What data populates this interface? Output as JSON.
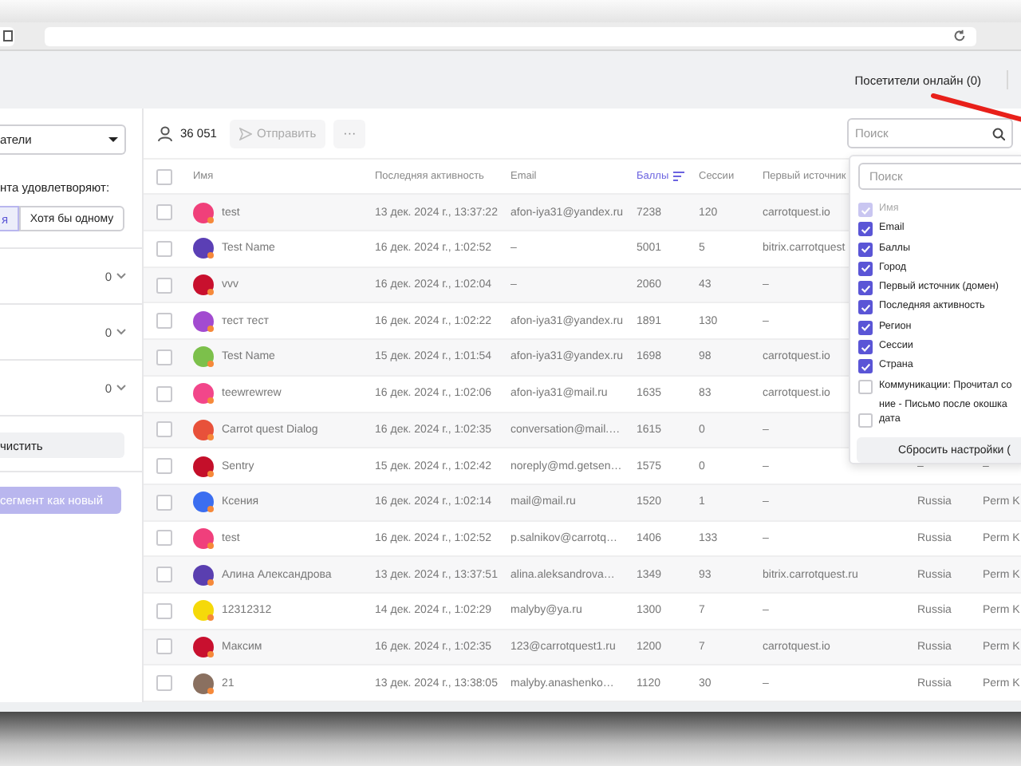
{
  "header": {
    "online_visitors": "Посетители онлайн (0)"
  },
  "sidebar": {
    "segment_select": "атели",
    "match_label": "нта удовлетворяют:",
    "match_modes": [
      {
        "label": "я",
        "selected": true
      },
      {
        "label": "Хотя бы одному",
        "selected": false
      }
    ],
    "filter_groups": [
      {
        "count": "0"
      },
      {
        "count": "0"
      },
      {
        "count": "0"
      }
    ],
    "clear_button": "чистить",
    "save_button": "сегмент как новый"
  },
  "toolbar": {
    "count": "36 051",
    "send_button": "Отправить",
    "more_button": "···",
    "search": {
      "placeholder": "Поиск"
    }
  },
  "table": {
    "select_all": {
      "checked": false
    },
    "columns": [
      {
        "label": "Имя",
        "sorted": false
      },
      {
        "label": "Последняя активность",
        "sorted": false
      },
      {
        "label": "Email",
        "sorted": false
      },
      {
        "label": "Баллы",
        "sorted": true
      },
      {
        "label": "Сессии",
        "sorted": false
      },
      {
        "label": "Первый источник",
        "sorted": false
      }
    ],
    "rows": [
      {
        "checked": false,
        "color": "#f0407a",
        "name": "test",
        "last_active": "13 дек. 2024 г., 13:37:22",
        "email": "afon-iya31@yandex.ru",
        "score": "7238",
        "sessions": "120",
        "source": "carrotquest.io"
      },
      {
        "checked": false,
        "color": "#5b3fb5",
        "name": "Test Name",
        "last_active": "16 дек. 2024 г., 1:02:52",
        "email": "–",
        "score": "5001",
        "sessions": "5",
        "source": "bitrix.carrotquest"
      },
      {
        "checked": false,
        "color": "#c8102e",
        "name": "vvv",
        "last_active": "16 дек. 2024 г., 1:02:04",
        "email": "–",
        "score": "2060",
        "sessions": "43",
        "source": "–"
      },
      {
        "checked": false,
        "color": "#a24bd0",
        "name": "тест тест",
        "last_active": "16 дек. 2024 г., 1:02:22",
        "email": "afon-iya31@yandex.ru",
        "score": "1891",
        "sessions": "130",
        "source": "–"
      },
      {
        "checked": false,
        "color": "#7cc04b",
        "name": "Test Name",
        "last_active": "15 дек. 2024 г., 1:01:54",
        "email": "afon-iya31@yandex.ru",
        "score": "1698",
        "sessions": "98",
        "source": "carrotquest.io"
      },
      {
        "checked": false,
        "color": "#f2468a",
        "name": "teewrewrew",
        "last_active": "16 дек. 2024 г., 1:02:06",
        "email": "afon-iya31@mail.ru",
        "score": "1635",
        "sessions": "83",
        "source": "carrotquest.io"
      },
      {
        "checked": false,
        "color": "#e8513a",
        "name": "Carrot quest Dialog",
        "last_active": "16 дек. 2024 г., 1:02:35",
        "email": "conversation@mail.…",
        "score": "1615",
        "sessions": "0",
        "source": "–"
      },
      {
        "checked": false,
        "color": "#c40f2a",
        "name": "Sentry",
        "last_active": "15 дек. 2024 г., 1:02:42",
        "email": "noreply@md.getsen…",
        "score": "1575",
        "sessions": "0",
        "source": "–",
        "country": "–",
        "city": "–"
      },
      {
        "checked": false,
        "color": "#3b6ef0",
        "name": "Ксения",
        "last_active": "16 дек. 2024 г., 1:02:14",
        "email": "mail@mail.ru",
        "score": "1520",
        "sessions": "1",
        "source": "–",
        "country": "Russia",
        "city": "Perm K"
      },
      {
        "checked": false,
        "color": "#f03f7c",
        "name": "test",
        "last_active": "16 дек. 2024 г., 1:02:52",
        "email": "p.salnikov@carrotq…",
        "score": "1406",
        "sessions": "133",
        "source": "–",
        "country": "Russia",
        "city": "Perm K"
      },
      {
        "checked": false,
        "color": "#5a3fb0",
        "name": "Алина Александрова",
        "last_active": "13 дек. 2024 г., 13:37:51",
        "email": "alina.aleksandrova…",
        "score": "1349",
        "sessions": "93",
        "source": "bitrix.carrotquest.ru",
        "country": "Russia",
        "city": "Perm K"
      },
      {
        "checked": false,
        "color": "#f5d90a",
        "name": "12312312",
        "last_active": "14 дек. 2024 г., 1:02:29",
        "email": "malyby@ya.ru",
        "score": "1300",
        "sessions": "7",
        "source": "–",
        "country": "Russia",
        "city": "Perm K"
      },
      {
        "checked": false,
        "color": "#c8102f",
        "name": "Максим",
        "last_active": "16 дек. 2024 г., 1:02:35",
        "email": "123@carrotquest1.ru",
        "score": "1200",
        "sessions": "7",
        "source": "carrotquest.io",
        "country": "Russia",
        "city": "Perm K"
      },
      {
        "checked": false,
        "color": "#8a7060",
        "name": "21",
        "last_active": "13 дек. 2024 г., 13:38:05",
        "email": "malyby.anashenko…",
        "score": "1120",
        "sessions": "30",
        "source": "–",
        "country": "Russia",
        "city": "Perm K"
      }
    ]
  },
  "column_picker": {
    "search": {
      "placeholder": "Поиск"
    },
    "options": [
      {
        "label_lines": [
          "Имя"
        ],
        "checked": true,
        "disabled": true
      },
      {
        "label_lines": [
          "Email"
        ],
        "checked": true,
        "disabled": false
      },
      {
        "label_lines": [
          "Баллы"
        ],
        "checked": true,
        "disabled": false
      },
      {
        "label_lines": [
          "Город"
        ],
        "checked": true,
        "disabled": false
      },
      {
        "label_lines": [
          "Первый источник (домен)"
        ],
        "checked": true,
        "disabled": false
      },
      {
        "label_lines": [
          "Последняя активность"
        ],
        "checked": true,
        "disabled": false
      },
      {
        "label_lines": [
          "Регион"
        ],
        "checked": true,
        "disabled": false
      },
      {
        "label_lines": [
          "Сессии"
        ],
        "checked": true,
        "disabled": false
      },
      {
        "label_lines": [
          "Страна"
        ],
        "checked": true,
        "disabled": false
      },
      {
        "label_lines": [
          "Коммуникации: Прочитал со",
          "ние - Письмо после окошка"
        ],
        "checked": false,
        "disabled": false
      },
      {
        "label_lines": [
          "дата"
        ],
        "checked": false,
        "disabled": false
      }
    ],
    "reset_button": "Сбросить настройки ("
  }
}
